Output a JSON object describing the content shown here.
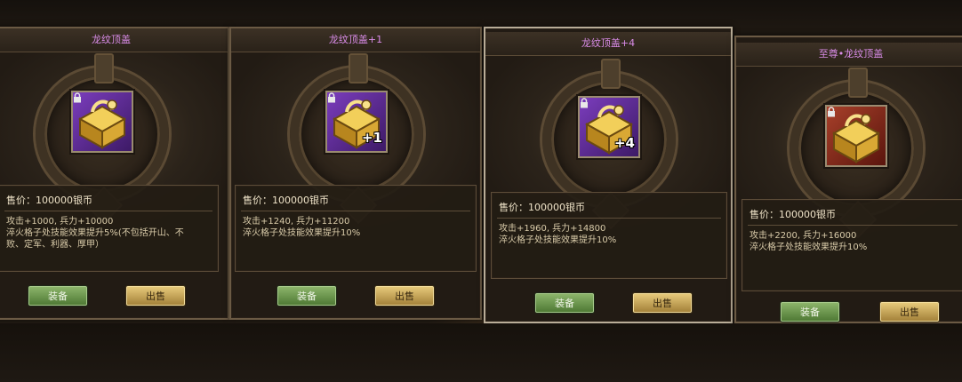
{
  "items": [
    {
      "title": "龙纹顶盖",
      "price": "售价：100000银币",
      "stats": [
        "攻击+1000, 兵力+10000",
        "淬火格子处技能效果提升5%(不包括开山、不",
        "败、定军、利器、厚甲）"
      ],
      "plus": "",
      "bg": "purple",
      "equip_label": "装备",
      "sell_label": "出售"
    },
    {
      "title": "龙纹顶盖+1",
      "price": "售价：100000银币",
      "stats": [
        "攻击+1240, 兵力+11200",
        "淬火格子处技能效果提升10%"
      ],
      "plus": "+1",
      "bg": "purple",
      "equip_label": "装备",
      "sell_label": "出售"
    },
    {
      "title": "龙纹顶盖+4",
      "price": "售价：100000银币",
      "stats": [
        "攻击+1960, 兵力+14800",
        "淬火格子处技能效果提升10%"
      ],
      "plus": "+4",
      "bg": "purple",
      "equip_label": "装备",
      "sell_label": "出售"
    },
    {
      "title": "至尊•龙纹顶盖",
      "price": "售价：100000银币",
      "stats": [
        "攻击+2200, 兵力+16000",
        "淬火格子处技能效果提升10%"
      ],
      "plus": "",
      "bg": "red",
      "equip_label": "装备",
      "sell_label": "出售"
    }
  ],
  "icons": {
    "item": "gold-chest-helmet-icon",
    "lock": "lock-icon"
  },
  "colors": {
    "title": "#d98ce8",
    "equip_button": "#5f8a44",
    "sell_button": "#c7a457"
  }
}
